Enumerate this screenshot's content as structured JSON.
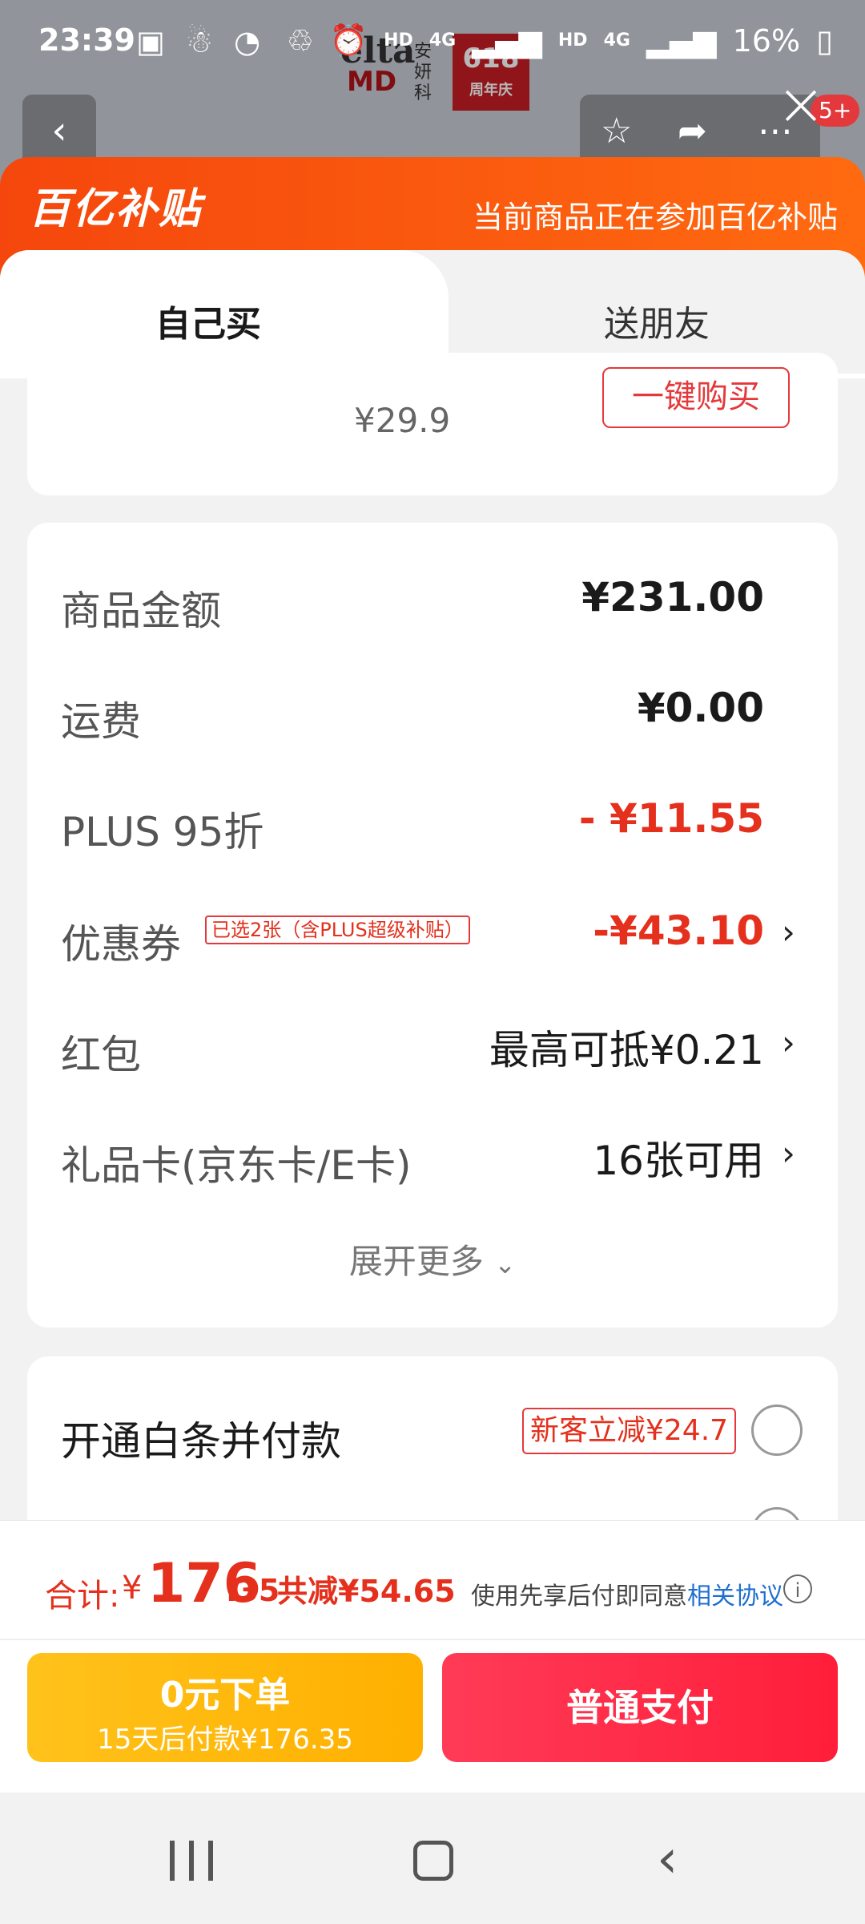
{
  "status_bar": {
    "time": "23:39",
    "network_1": "HD",
    "network_2": "4G",
    "network_3": "HD",
    "network_4": "4G",
    "battery": "16%"
  },
  "background_page": {
    "brand_line1": "elta",
    "brand_line2": "MD",
    "brand_cn": "安妍科",
    "event_badge": "618",
    "event_sub": "周年庆",
    "badge_count": "5+"
  },
  "banner": {
    "logo": "百亿补贴",
    "notice": "当前商品正在参加百亿补贴"
  },
  "tabs": {
    "self": "自己买",
    "friend": "送朋友"
  },
  "product_card": {
    "price": "¥29.9",
    "buy_button": "一键购买"
  },
  "summary": {
    "rows": [
      {
        "label": "商品金额",
        "value": "¥231.00"
      },
      {
        "label": "运费",
        "value": "¥0.00"
      },
      {
        "label": "PLUS 95折",
        "value": "- ¥11.55"
      },
      {
        "label": "优惠券",
        "tag": "已选2张（含PLUS超级补贴）",
        "value": "-¥43.10"
      },
      {
        "label": "红包",
        "value": "最高可抵¥0.21"
      },
      {
        "label": "礼品卡(京东卡/E卡)",
        "value": "16张可用"
      }
    ],
    "expand": "展开更多"
  },
  "payment": {
    "baitiao_label": "开通白条并付款",
    "baitiao_promo": "新客立减¥24.7"
  },
  "footer": {
    "total_label": "合计:",
    "currency": "¥",
    "total_int": "176",
    "total_dec": ".35",
    "saved": "共减¥54.65",
    "agreement_prefix": "使用先享后付即同意",
    "agreement_link": "相关协议",
    "later_title": "0元下单",
    "later_sub": "15天后付款¥176.35",
    "pay_button": "普通支付"
  },
  "colors": {
    "accent_red": "#e4301c",
    "banner_orange": "#f5470d",
    "later_yellow": "#ffb000",
    "pay_red": "#ff1e3a"
  }
}
